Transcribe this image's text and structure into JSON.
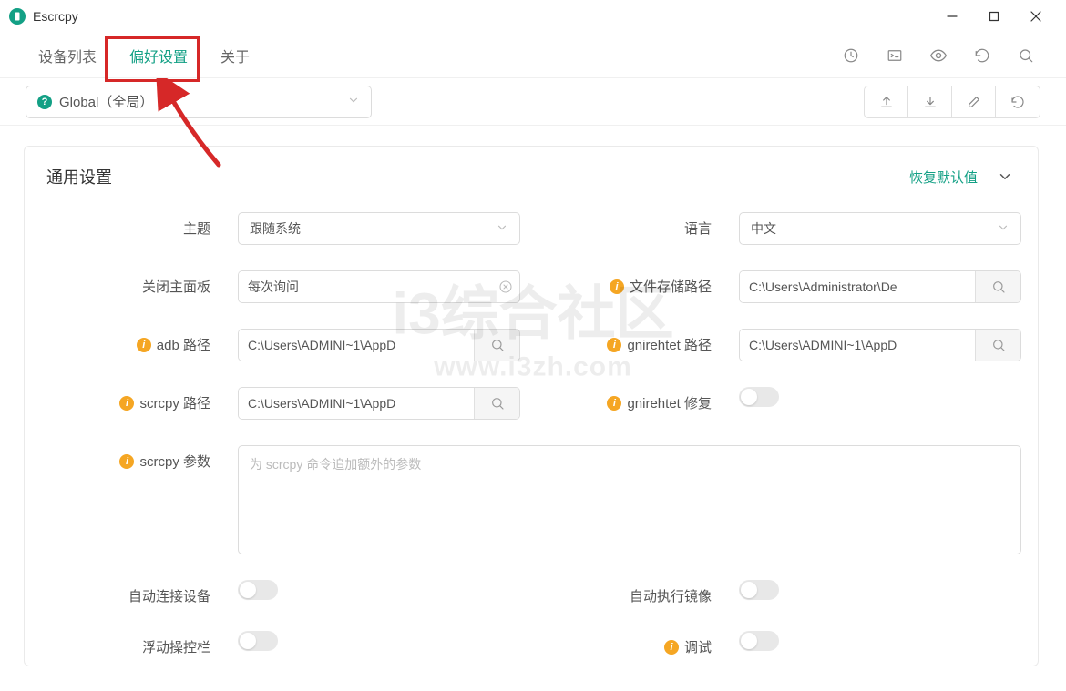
{
  "titlebar": {
    "app_name": "Escrcpy"
  },
  "tabs": {
    "devices": "设备列表",
    "preferences": "偏好设置",
    "about": "关于"
  },
  "scope": {
    "label": "Global（全局）"
  },
  "section": {
    "general_title": "通用设置",
    "reset_label": "恢复默认值"
  },
  "form": {
    "theme_label": "主题",
    "theme_value": "跟随系统",
    "language_label": "语言",
    "language_value": "中文",
    "close_panel_label": "关闭主面板",
    "close_panel_value": "每次询问",
    "file_path_label": "文件存储路径",
    "file_path_value": "C:\\Users\\Administrator\\De",
    "adb_path_label": "adb 路径",
    "adb_path_value": "C:\\Users\\ADMINI~1\\AppD",
    "gnirehtet_path_label": "gnirehtet 路径",
    "gnirehtet_path_value": "C:\\Users\\ADMINI~1\\AppD",
    "scrcpy_path_label": "scrcpy 路径",
    "scrcpy_path_value": "C:\\Users\\ADMINI~1\\AppD",
    "gnirehtet_fix_label": "gnirehtet 修复",
    "scrcpy_args_label": "scrcpy 参数",
    "scrcpy_args_placeholder": "为 scrcpy 命令追加额外的参数",
    "auto_connect_label": "自动连接设备",
    "auto_mirror_label": "自动执行镜像",
    "float_bar_label": "浮动操控栏",
    "debug_label": "调试"
  },
  "watermark": {
    "main": "i3综合社区",
    "sub": "www.i3zh.com"
  }
}
